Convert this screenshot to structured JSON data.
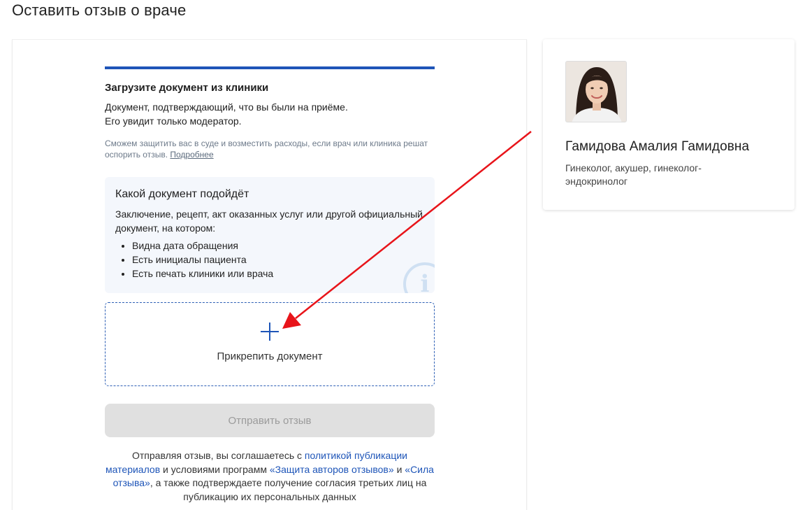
{
  "page": {
    "title": "Оставить отзыв о враче"
  },
  "upload": {
    "title": "Загрузите документ из клиники",
    "description_line1": "Документ, подтверждающий, что вы были на приёме.",
    "description_line2": "Его увидит только модератор.",
    "legal_note": "Сможем защитить вас в суде и возместить расходы, если врач или клиника решат оспорить отзыв.",
    "legal_link": "Подробнее"
  },
  "info_box": {
    "title": "Какой документ подойдёт",
    "text": "Заключение, рецепт, акт оказанных услуг или другой официальный документ, на котором:",
    "items": [
      "Видна дата обращения",
      "Есть инициалы пациента",
      "Есть печать клиники или врача"
    ],
    "icon": "info-icon"
  },
  "attach": {
    "label": "Прикрепить документ",
    "icon": "plus-icon"
  },
  "submit": {
    "label": "Отправить отзыв"
  },
  "agreement": {
    "part1": "Отправляя отзыв, вы соглашаетесь с",
    "link1": "политикой публикации материалов",
    "part2": "и условиями программ",
    "link2": "«Защита авторов отзывов»",
    "part3": "и",
    "link3": "«Сила отзыва»",
    "part4": ", а также подтверждаете получение согласия третьих лиц на публикацию их персональных данных"
  },
  "doctor": {
    "name": "Гамидова Амалия Гамидовна",
    "specialty": "Гинеколог, акушер, гинеколог-эндокринолог"
  },
  "colors": {
    "accent": "#1e55b8",
    "annotation_arrow": "#e8141a",
    "info_background": "#f4f7fc",
    "button_disabled": "#e0e0e0"
  }
}
